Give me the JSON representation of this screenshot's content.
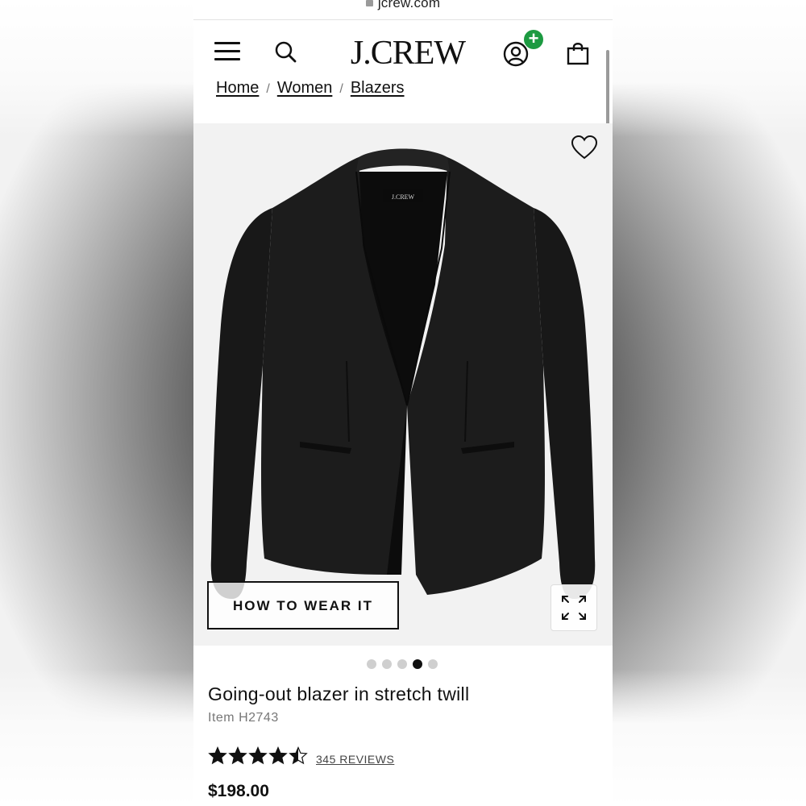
{
  "browser": {
    "url": "jcrew.com"
  },
  "header": {
    "logo": "J.CREW",
    "menu_icon": "hamburger-menu-icon",
    "search_icon": "search-icon",
    "account_icon": "account-icon",
    "account_badge": "+",
    "bag_icon": "shopping-bag-icon"
  },
  "breadcrumb": [
    {
      "label": "Home"
    },
    {
      "label": "Women"
    },
    {
      "label": "Blazers"
    }
  ],
  "breadcrumb_separator": "/",
  "product": {
    "how_to_wear_label": "HOW TO WEAR IT",
    "image_count": 5,
    "active_image_index": 3,
    "title": "Going-out blazer in stretch twill",
    "item_code": "Item H2743",
    "rating": 4.5,
    "rating_max": 5,
    "reviews_label": "345 REVIEWS",
    "price": "$198.00",
    "garment_label": "J.CREW"
  },
  "colors": {
    "account_badge": "#1c9a41",
    "image_bg": "#f2f2f2"
  }
}
